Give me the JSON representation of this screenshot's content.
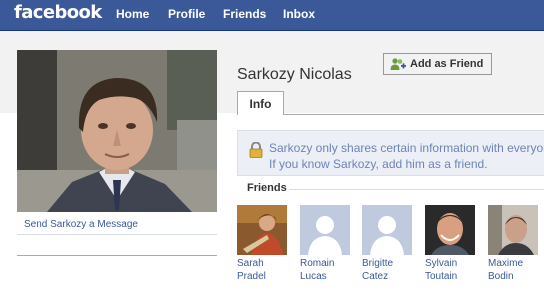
{
  "header": {
    "logo": "facebook",
    "nav": [
      {
        "label": "Home"
      },
      {
        "label": "Profile"
      },
      {
        "label": "Friends"
      },
      {
        "label": "Inbox"
      }
    ]
  },
  "profile": {
    "name": "Sarkozy Nicolas",
    "add_friend_label": "Add as Friend",
    "send_message_label": "Send Sarkozy a Message",
    "tabs": [
      {
        "label": "Info"
      }
    ],
    "notice": "Sarkozy only shares certain information with everyone. If you know Sarkozy, add him as a friend."
  },
  "friends": {
    "title": "Friends",
    "items": [
      {
        "first": "Sarah",
        "last": "Pradel",
        "photo": "photo"
      },
      {
        "first": "Romain",
        "last": "Lucas",
        "photo": "silhouette"
      },
      {
        "first": "Brigitte",
        "last": "Catez",
        "photo": "silhouette"
      },
      {
        "first": "Sylvain",
        "last": "Toutain",
        "photo": "photo"
      },
      {
        "first": "Maxime",
        "last": "Bodin",
        "photo": "photo"
      }
    ]
  },
  "colors": {
    "brand_blue": "#3b5998",
    "link_blue": "#3b5998",
    "notice_bg": "#eceff5"
  }
}
